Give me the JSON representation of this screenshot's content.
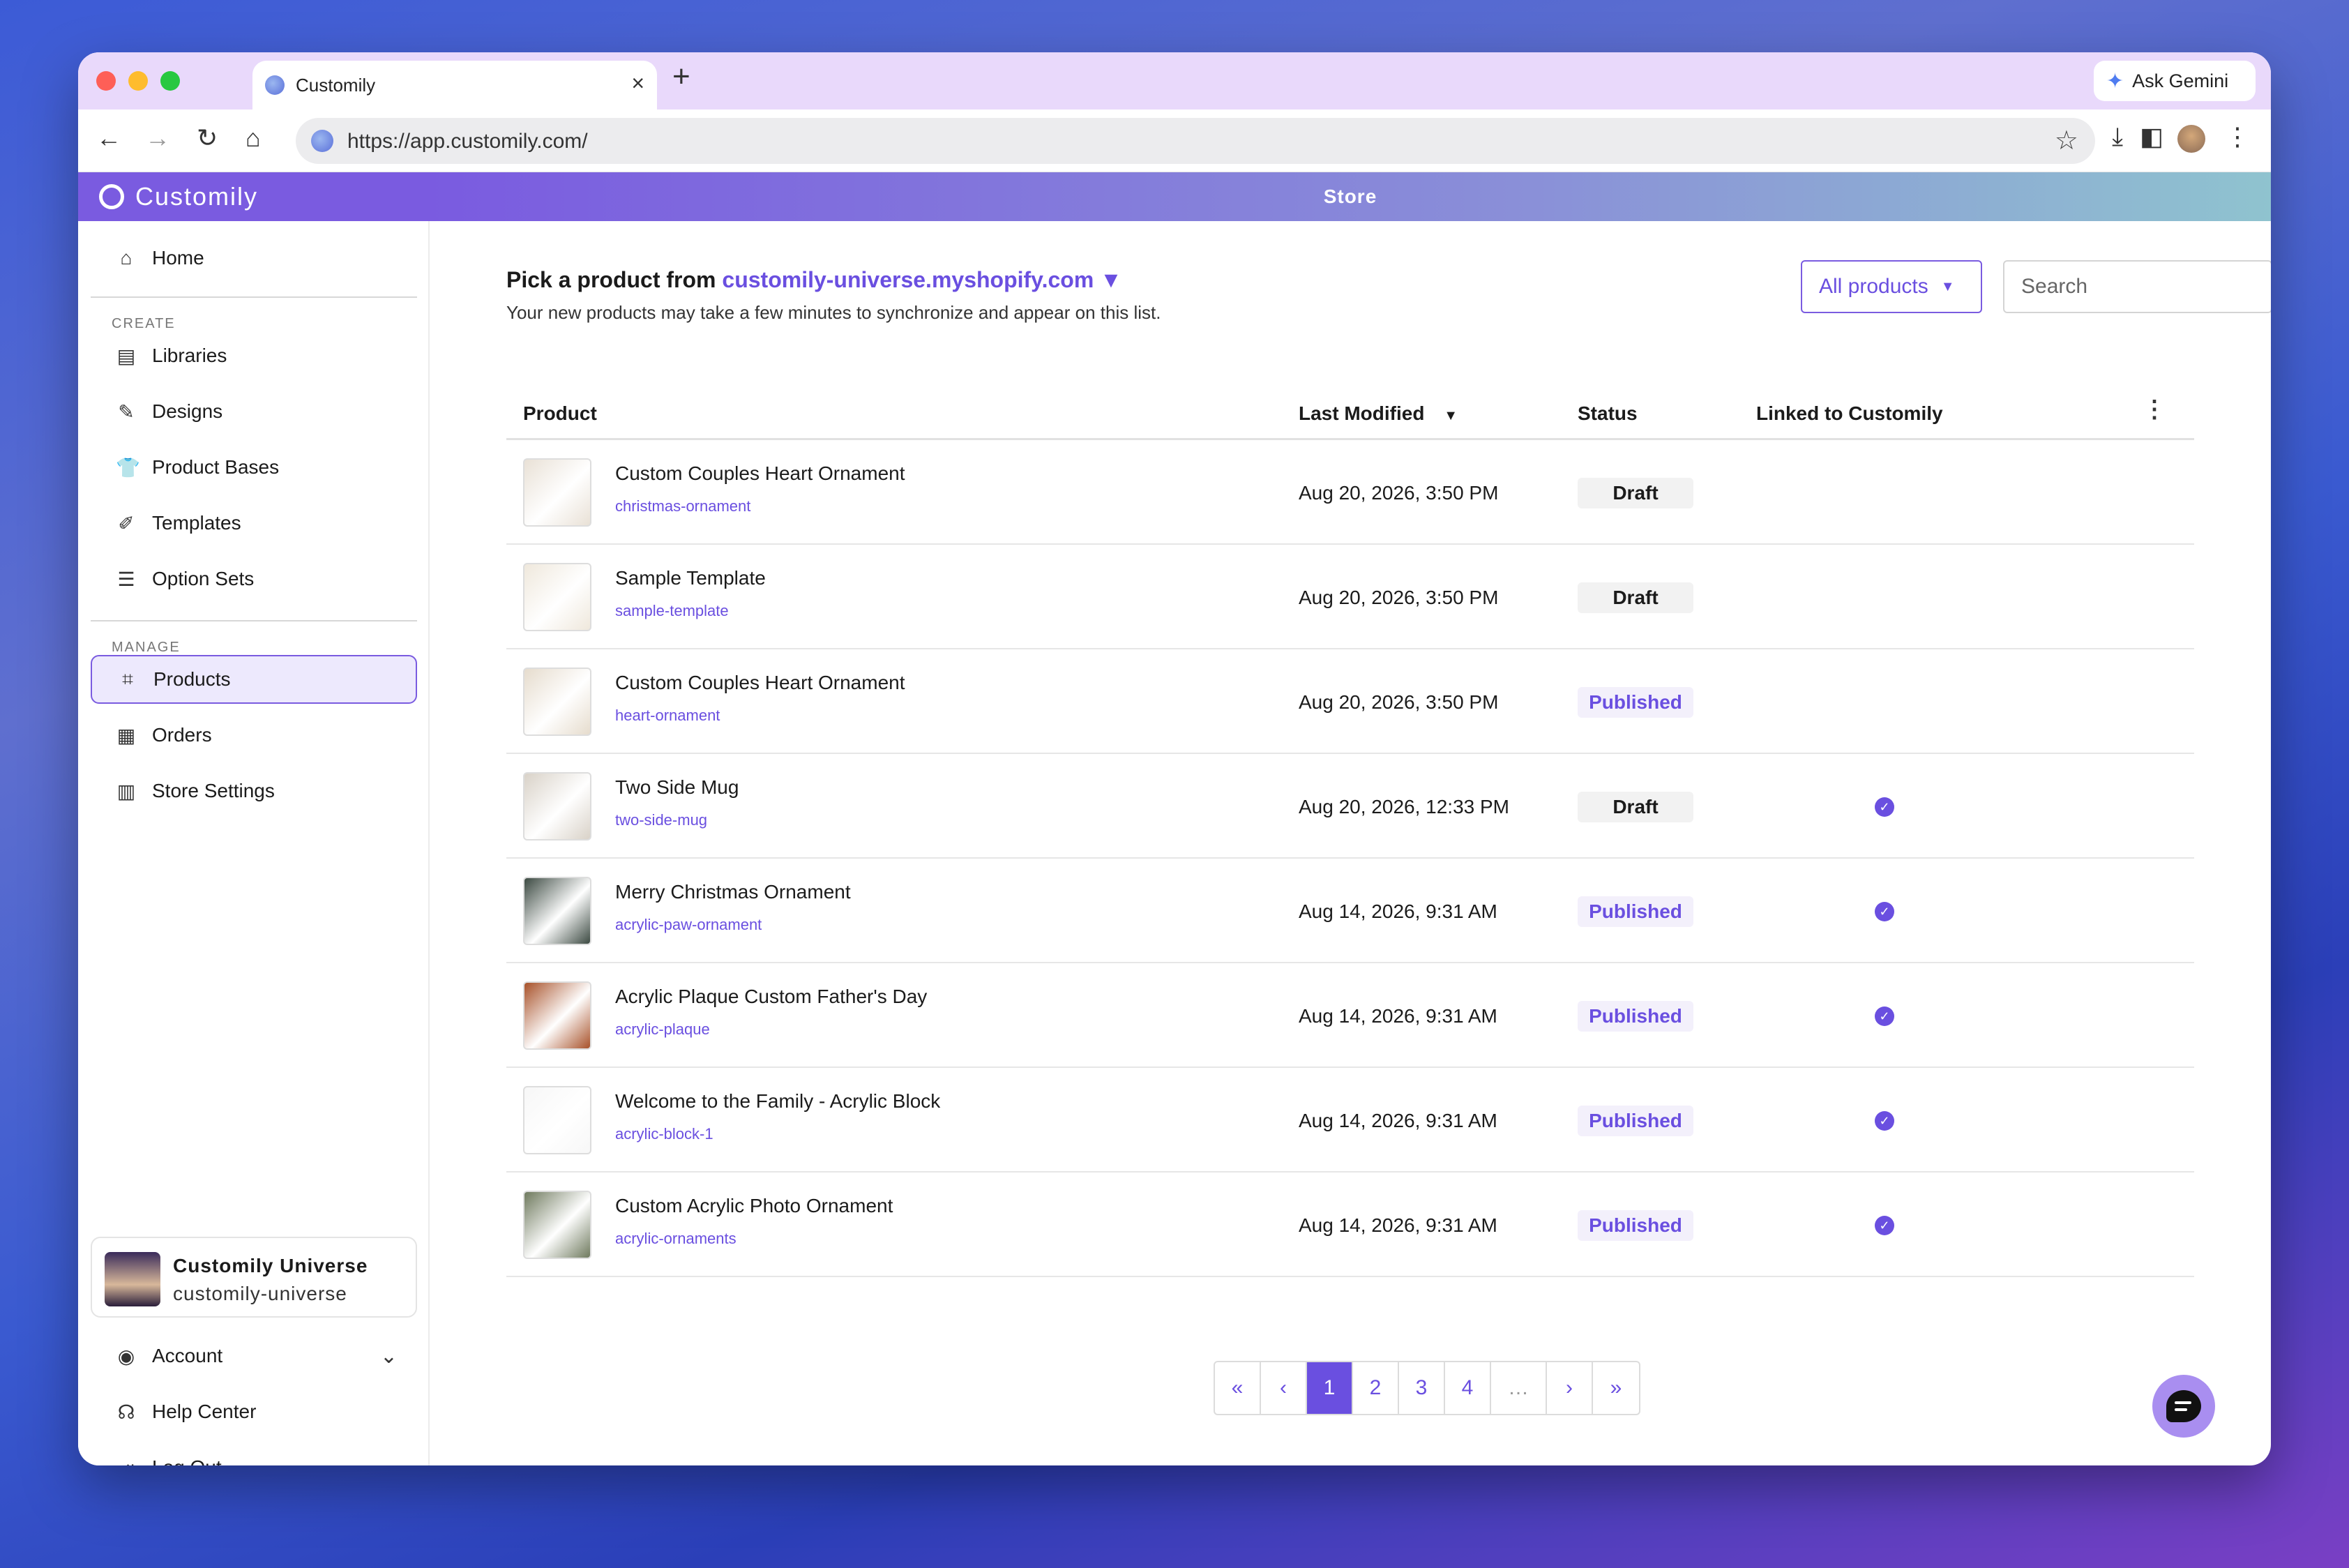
{
  "browser": {
    "tab_title": "Customily",
    "tab_close": "×",
    "new_tab": "+",
    "tab_list": "⌄",
    "ask_gemini": "Ask Gemini",
    "url": "https://app.customily.com/",
    "nav": {
      "back": "←",
      "forward": "→",
      "reload": "↻",
      "home": "⌂"
    },
    "toolbar": {
      "star": "☆",
      "download": "⤓",
      "sidepanel": "◧",
      "menu": "⋮"
    }
  },
  "app": {
    "brand": "Customily",
    "header_title": "Store"
  },
  "sidebar": {
    "home": {
      "label": "Home",
      "icon": "⌂"
    },
    "create_label": "CREATE",
    "create_items": [
      {
        "label": "Libraries",
        "icon": "▤"
      },
      {
        "label": "Designs",
        "icon": "✎"
      },
      {
        "label": "Product Bases",
        "icon": "👕"
      },
      {
        "label": "Templates",
        "icon": "✐"
      },
      {
        "label": "Option Sets",
        "icon": "☰"
      }
    ],
    "manage_label": "MANAGE",
    "manage_items": [
      {
        "label": "Products",
        "icon": "⌗",
        "active": true
      },
      {
        "label": "Orders",
        "icon": "▦"
      },
      {
        "label": "Store Settings",
        "icon": "▥"
      }
    ],
    "user": {
      "name": "Customily Universe",
      "handle": "customily-universe"
    },
    "bottom_items": [
      {
        "label": "Account",
        "icon": "◉",
        "chevron": "⌄"
      },
      {
        "label": "Help Center",
        "icon": "☊"
      },
      {
        "label": "Log Out",
        "icon": "⇥"
      }
    ]
  },
  "main": {
    "pick_prefix": "Pick a product from",
    "store_name": "customily-universe.myshopify.com",
    "store_caret": "▼",
    "subtitle": "Your new products may take a few minutes to synchronize and appear on this list.",
    "filter_value": "All products",
    "filter_caret": "▼",
    "search_placeholder": "Search",
    "columns": {
      "product": "Product",
      "last_modified": "Last Modified",
      "sort_caret": "▼",
      "status": "Status",
      "linked": "Linked to Customily",
      "menu": "⋮"
    },
    "rows": [
      {
        "name": "Custom Couples Heart Ornament",
        "handle": "christmas-ornament",
        "date": "Aug 20, 2026, 3:50 PM",
        "status": "Draft",
        "linked": false,
        "thumb_color": "#e9e1d6"
      },
      {
        "name": "Sample Template",
        "handle": "sample-template",
        "date": "Aug 20, 2026, 3:50 PM",
        "status": "Draft",
        "linked": false,
        "thumb_color": "#efe8dc"
      },
      {
        "name": "Custom Couples Heart Ornament",
        "handle": "heart-ornament",
        "date": "Aug 20, 2026, 3:50 PM",
        "status": "Published",
        "linked": false,
        "thumb_color": "#e6dccd"
      },
      {
        "name": "Two Side Mug",
        "handle": "two-side-mug",
        "date": "Aug 20, 2026, 12:33 PM",
        "status": "Draft",
        "linked": true,
        "thumb_color": "#d9d2c8"
      },
      {
        "name": "Merry Christmas Ornament",
        "handle": "acrylic-paw-ornament",
        "date": "Aug 14, 2026, 9:31 AM",
        "status": "Published",
        "linked": true,
        "thumb_color": "#3c4a42"
      },
      {
        "name": "Acrylic Plaque Custom Father's Day",
        "handle": "acrylic-plaque",
        "date": "Aug 14, 2026, 9:31 AM",
        "status": "Published",
        "linked": true,
        "thumb_color": "#a8522a"
      },
      {
        "name": "Welcome to the Family - Acrylic Block",
        "handle": "acrylic-block-1",
        "date": "Aug 14, 2026, 9:31 AM",
        "status": "Published",
        "linked": true,
        "thumb_color": "#f7f7f7"
      },
      {
        "name": "Custom Acrylic Photo Ornament",
        "handle": "acrylic-ornaments",
        "date": "Aug 14, 2026, 9:31 AM",
        "status": "Published",
        "linked": true,
        "thumb_color": "#6f7a5e"
      }
    ],
    "pagination": [
      "«",
      "‹",
      "1",
      "2",
      "3",
      "4",
      "…",
      "›",
      "»"
    ],
    "current_page": "1"
  },
  "colors": {
    "accent": "#6a4fe0",
    "brand": "#7a5be0"
  }
}
